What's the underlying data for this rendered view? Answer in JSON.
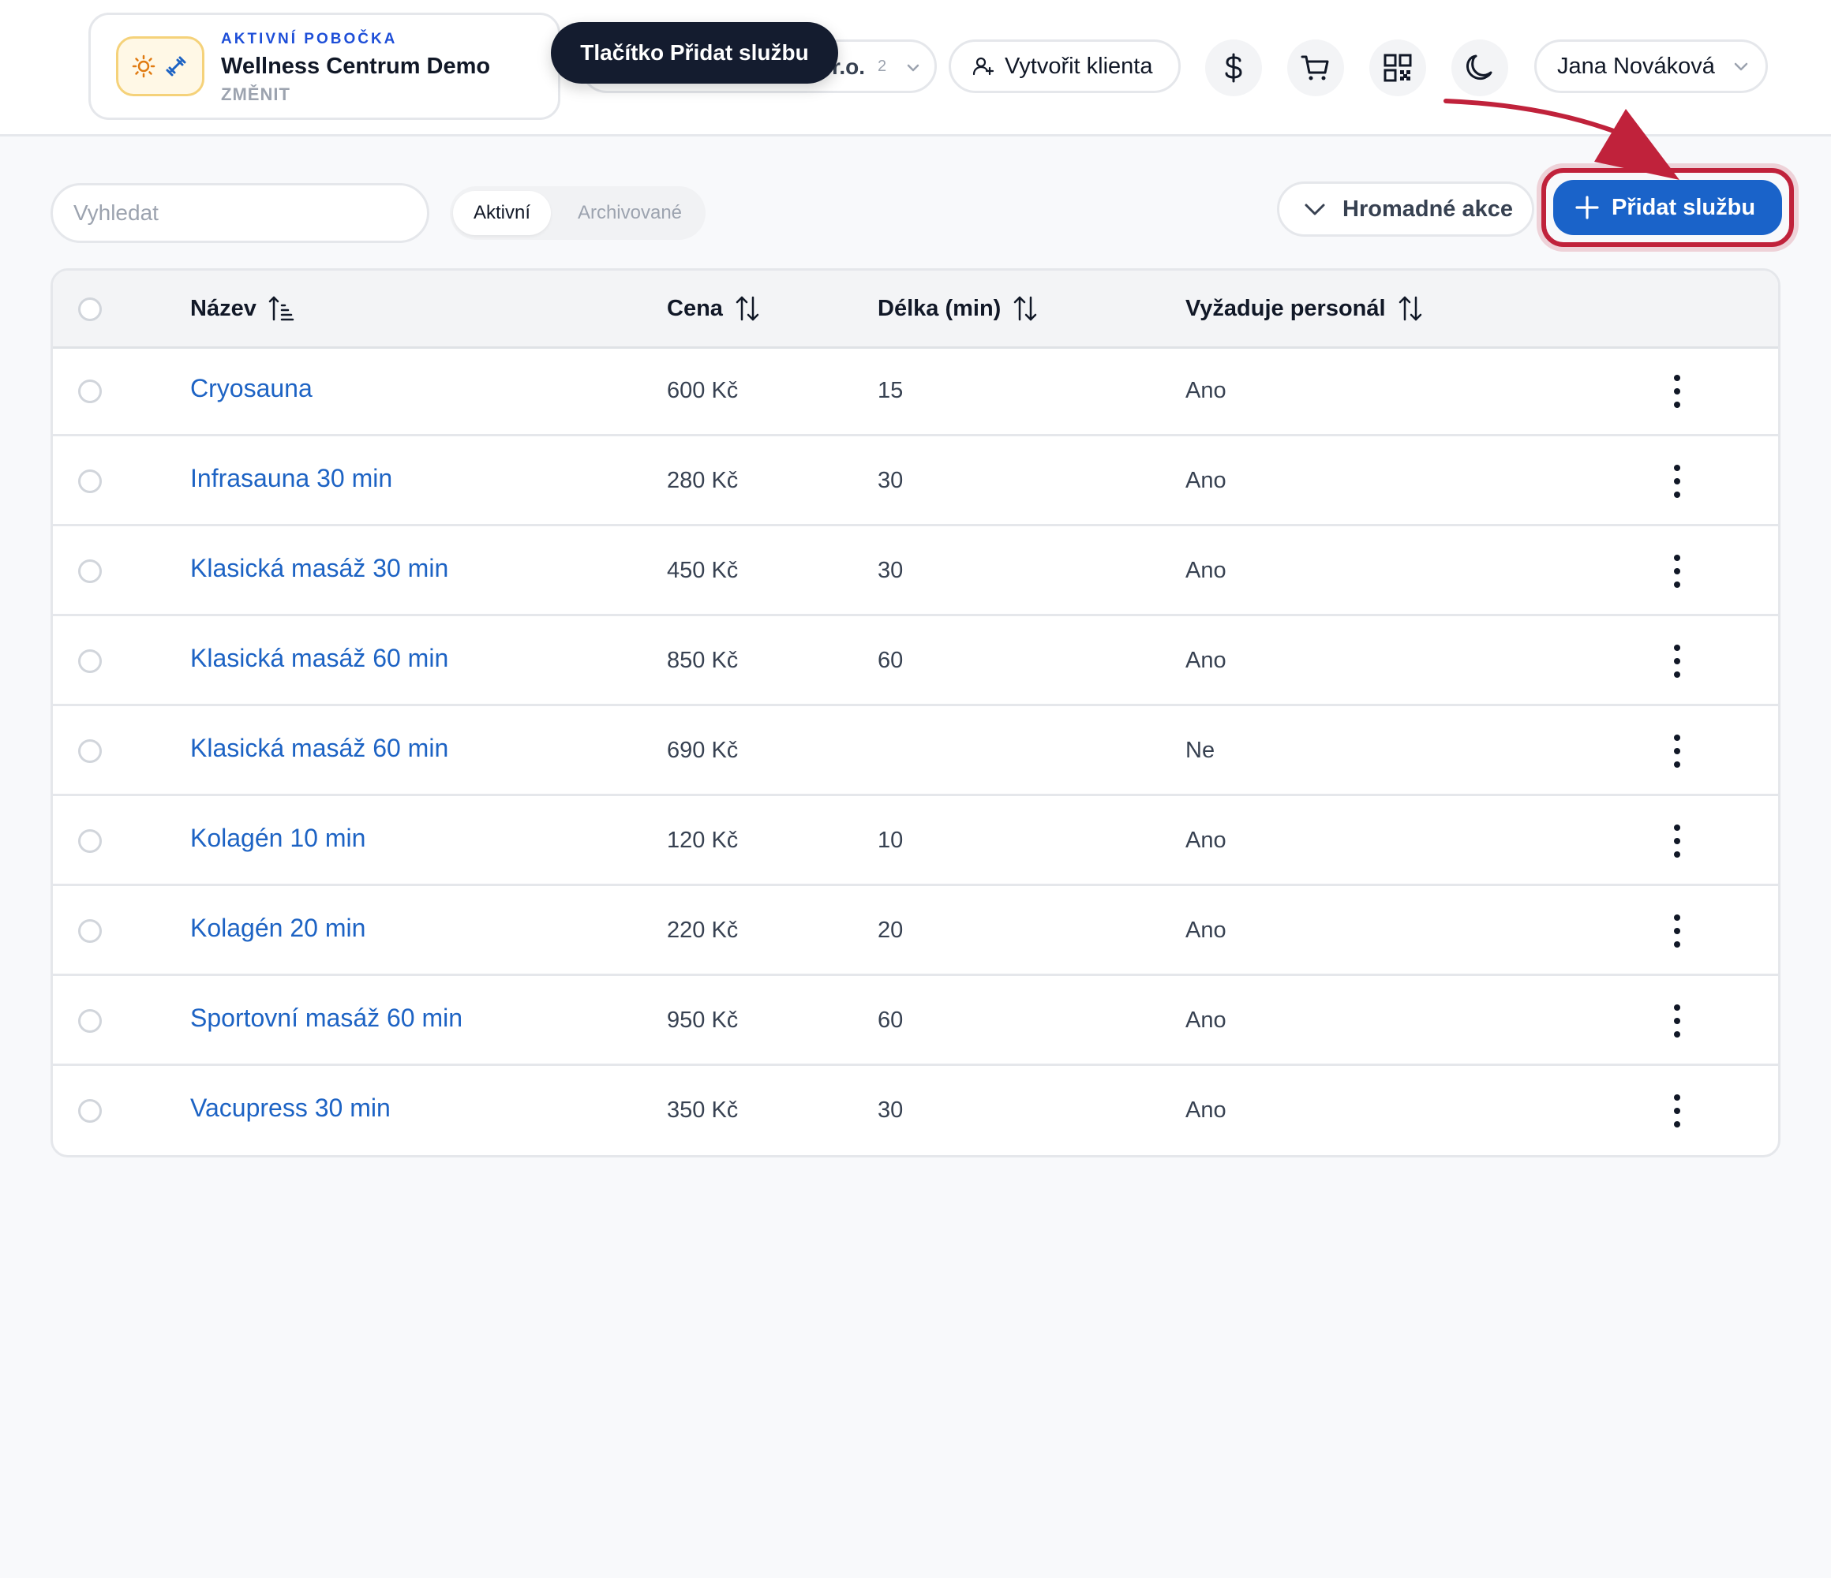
{
  "branch": {
    "eyebrow": "AKTIVNÍ POBOČKA",
    "name": "Wellness Centrum Demo",
    "change_label": "ZMĚNIT"
  },
  "org_switch": {
    "visible_tail": "r.o.",
    "count": "2"
  },
  "tooltip": "Tlačítko Přidat službu",
  "header": {
    "create_client_label": "Vytvořit klienta",
    "icons": [
      "dollar-icon",
      "cart-icon",
      "qr-code-icon",
      "moon-icon"
    ],
    "user_name": "Jana Nováková"
  },
  "toolbar": {
    "search_placeholder": "Vyhledat",
    "tabs": [
      {
        "label": "Aktivní",
        "active": true
      },
      {
        "label": "Archivované",
        "active": false
      }
    ],
    "bulk_actions_label": "Hromadné akce",
    "add_service_label": "Přidat službu"
  },
  "colors": {
    "primary": "#1a63c9",
    "highlight": "#c0223b",
    "link": "#1d63c4",
    "tooltip_bg": "#141c2f"
  },
  "table": {
    "columns": [
      "Název",
      "Cena",
      "Délka (min)",
      "Vyžaduje personál"
    ],
    "rows": [
      {
        "name": "Cryosauna",
        "price": "600 Kč",
        "length": "15",
        "staff": "Ano"
      },
      {
        "name": "Infrasauna 30 min",
        "price": "280 Kč",
        "length": "30",
        "staff": "Ano"
      },
      {
        "name": "Klasická masáž 30 min",
        "price": "450 Kč",
        "length": "30",
        "staff": "Ano"
      },
      {
        "name": "Klasická masáž 60 min",
        "price": "850 Kč",
        "length": "60",
        "staff": "Ano"
      },
      {
        "name": "Klasická masáž 60 min",
        "price": "690 Kč",
        "length": "",
        "staff": "Ne"
      },
      {
        "name": "Kolagén 10 min",
        "price": "120 Kč",
        "length": "10",
        "staff": "Ano"
      },
      {
        "name": "Kolagén 20 min",
        "price": "220 Kč",
        "length": "20",
        "staff": "Ano"
      },
      {
        "name": "Sportovní masáž 60 min",
        "price": "950 Kč",
        "length": "60",
        "staff": "Ano"
      },
      {
        "name": "Vacupress 30 min",
        "price": "350 Kč",
        "length": "30",
        "staff": "Ano"
      }
    ]
  }
}
